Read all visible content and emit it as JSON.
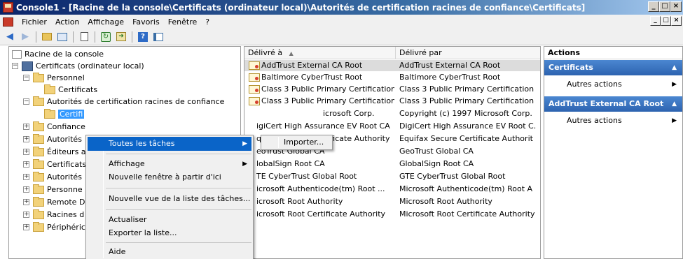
{
  "window": {
    "title": "Console1 - [Racine de la console\\Certificats (ordinateur local)\\Autorités de certification racines de confiance\\Certificats]",
    "min_glyph": "_",
    "max_glyph": "□",
    "close_glyph": "×"
  },
  "menubar": {
    "items": [
      "Fichier",
      "Action",
      "Affichage",
      "Favoris",
      "Fenêtre",
      "?"
    ]
  },
  "tree": {
    "root": "Racine de la console",
    "certs_local": "Certificats (ordinateur local)",
    "personnel": "Personnel",
    "personnel_certs": "Certificats",
    "trusted_root": "Autorités de certification racines de confiance",
    "trusted_root_certs": "Certifi",
    "children": [
      "Confiance",
      "Autorités",
      "Éditeurs a",
      "Certificats",
      "Autorités",
      "Personne",
      "Remote D",
      "Racines d",
      "Périphéric"
    ]
  },
  "list": {
    "col_issued_to": "Délivré à",
    "col_issued_by": "Délivré par",
    "sort_glyph": "▲",
    "rows": [
      {
        "to": "AddTrust External CA Root",
        "by": "AddTrust External CA Root"
      },
      {
        "to": "Baltimore CyberTrust Root",
        "by": "Baltimore CyberTrust Root"
      },
      {
        "to": "Class 3 Public Primary Certification...",
        "by": "Class 3 Public Primary Certification"
      },
      {
        "to": "Class 3 Public Primary Certification...",
        "by": "Class 3 Public Primary Certification"
      },
      {
        "to": "icrosoft Corp.",
        "by": "Copyright (c) 1997 Microsoft Corp."
      },
      {
        "to": "igiCert High Assurance EV Root CA",
        "by": "DigiCert High Assurance EV Root C."
      },
      {
        "to": "quifax Secure Certificate Authority",
        "by": "Equifax Secure Certificate Authorit"
      },
      {
        "to": "eoTrust Global CA",
        "by": "GeoTrust Global CA"
      },
      {
        "to": "lobalSign Root CA",
        "by": "GlobalSign Root CA"
      },
      {
        "to": "TE CyberTrust Global Root",
        "by": "GTE CyberTrust Global Root"
      },
      {
        "to": "icrosoft Authenticode(tm) Root ...",
        "by": "Microsoft Authenticode(tm) Root A"
      },
      {
        "to": "icrosoft Root Authority",
        "by": "Microsoft Root Authority"
      },
      {
        "to": "icrosoft Root Certificate Authority",
        "by": "Microsoft Root Certificate Authority"
      }
    ]
  },
  "actions": {
    "header": "Actions",
    "group1": "Certificats",
    "group1_item": "Autres actions",
    "group2": "AddTrust External CA Root",
    "group2_item": "Autres actions",
    "collapse_glyph": "▲",
    "more_glyph": "▶"
  },
  "context_menu": {
    "all_tasks": "Toutes les tâches",
    "view": "Affichage",
    "new_window": "Nouvelle fenêtre à partir d'ici",
    "new_taskpad": "Nouvelle vue de la liste des tâches...",
    "refresh": "Actualiser",
    "export": "Exporter la liste...",
    "help": "Aide",
    "submenu_glyph": "▶"
  },
  "submenu": {
    "import": "Importer..."
  },
  "colors": {
    "menu_highlight": "#0a64c8",
    "action_group": "#2d63b0",
    "selection": "#3399ff"
  }
}
